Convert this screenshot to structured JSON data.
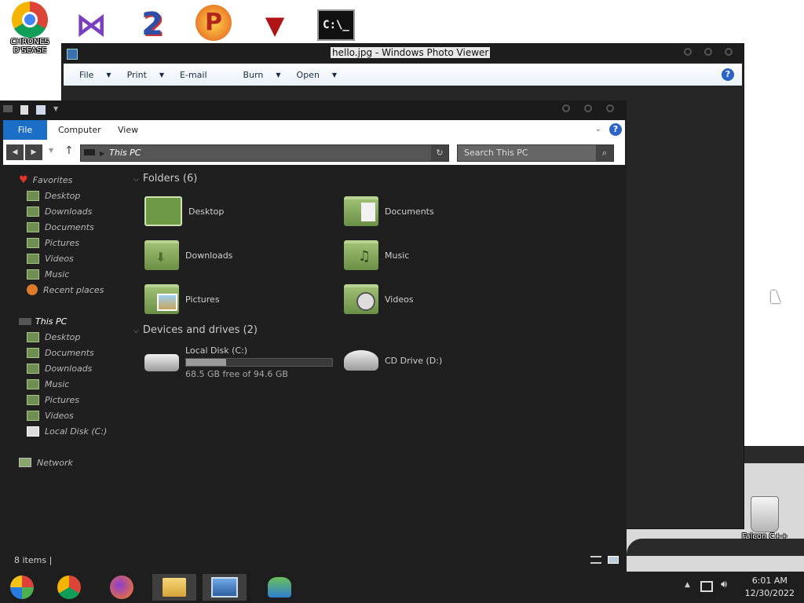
{
  "desktop": {
    "top_icon_label": "CHRONES D'SEASE",
    "recycle_label": "Falcon C++"
  },
  "photo_viewer": {
    "title": "hello.jpg - Windows Photo Viewer",
    "menu": [
      "File",
      "Print",
      "E-mail",
      "Burn",
      "Open"
    ]
  },
  "explorer": {
    "ribbon_tabs": [
      "File",
      "Computer",
      "View"
    ],
    "address": "This PC",
    "search_placeholder": "Search This PC",
    "nav": {
      "favorites_label": "Favorites",
      "favorites": [
        "Desktop",
        "Downloads",
        "Documents",
        "Pictures",
        "Videos",
        "Music",
        "Recent places"
      ],
      "thispc_label": "This PC",
      "thispc": [
        "Desktop",
        "Documents",
        "Downloads",
        "Music",
        "Pictures",
        "Videos",
        "Local Disk (C:)"
      ],
      "network_label": "Network"
    },
    "folders_header": "Folders (6)",
    "folders": [
      "Desktop",
      "Documents",
      "Downloads",
      "Music",
      "Pictures",
      "Videos"
    ],
    "drives_header": "Devices and drives (2)",
    "drives": [
      {
        "name": "Local Disk (C:)",
        "free": "68.5 GB free of 94.6 GB",
        "used_fraction": 0.276
      },
      {
        "name": "CD Drive (D:)"
      }
    ],
    "status": "8 items"
  },
  "taskbar": {
    "time": "6:01 AM",
    "date": "12/30/2022"
  },
  "colors": {
    "accent": "#1b6fc7",
    "folder": "#7fa653",
    "dark_bg": "#1f1f1f"
  }
}
